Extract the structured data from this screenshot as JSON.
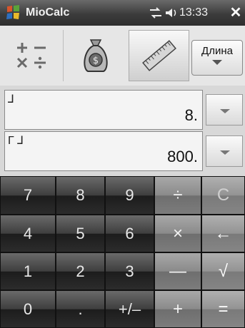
{
  "titlebar": {
    "app_title": "MioCalc",
    "time": "13:33",
    "close_label": "✕",
    "icons": [
      "windows-start-icon",
      "connectivity-icon",
      "volume-icon"
    ]
  },
  "toolbar": {
    "modes": [
      {
        "name": "arithmetic",
        "icon": "arithmetic-icon"
      },
      {
        "name": "currency",
        "icon": "money-bag-icon"
      },
      {
        "name": "length",
        "icon": "ruler-icon",
        "active": true
      }
    ],
    "unit_label": "Длина"
  },
  "fields": [
    {
      "unit_symbol": "⅃",
      "value": "8."
    },
    {
      "unit_symbol": "Г ⅃",
      "value": "800."
    }
  ],
  "keypad": {
    "rows": [
      [
        "7",
        "8",
        "9",
        "÷",
        "C"
      ],
      [
        "4",
        "5",
        "6",
        "×",
        "←"
      ],
      [
        "1",
        "2",
        "3",
        "—",
        "√"
      ],
      [
        "0",
        ".",
        "+/–",
        "+",
        "="
      ]
    ]
  },
  "colors": {
    "titlebar": "#3c3c3c",
    "keypad_number": "#2c2c2c",
    "keypad_operator": "#8a8a8a"
  }
}
